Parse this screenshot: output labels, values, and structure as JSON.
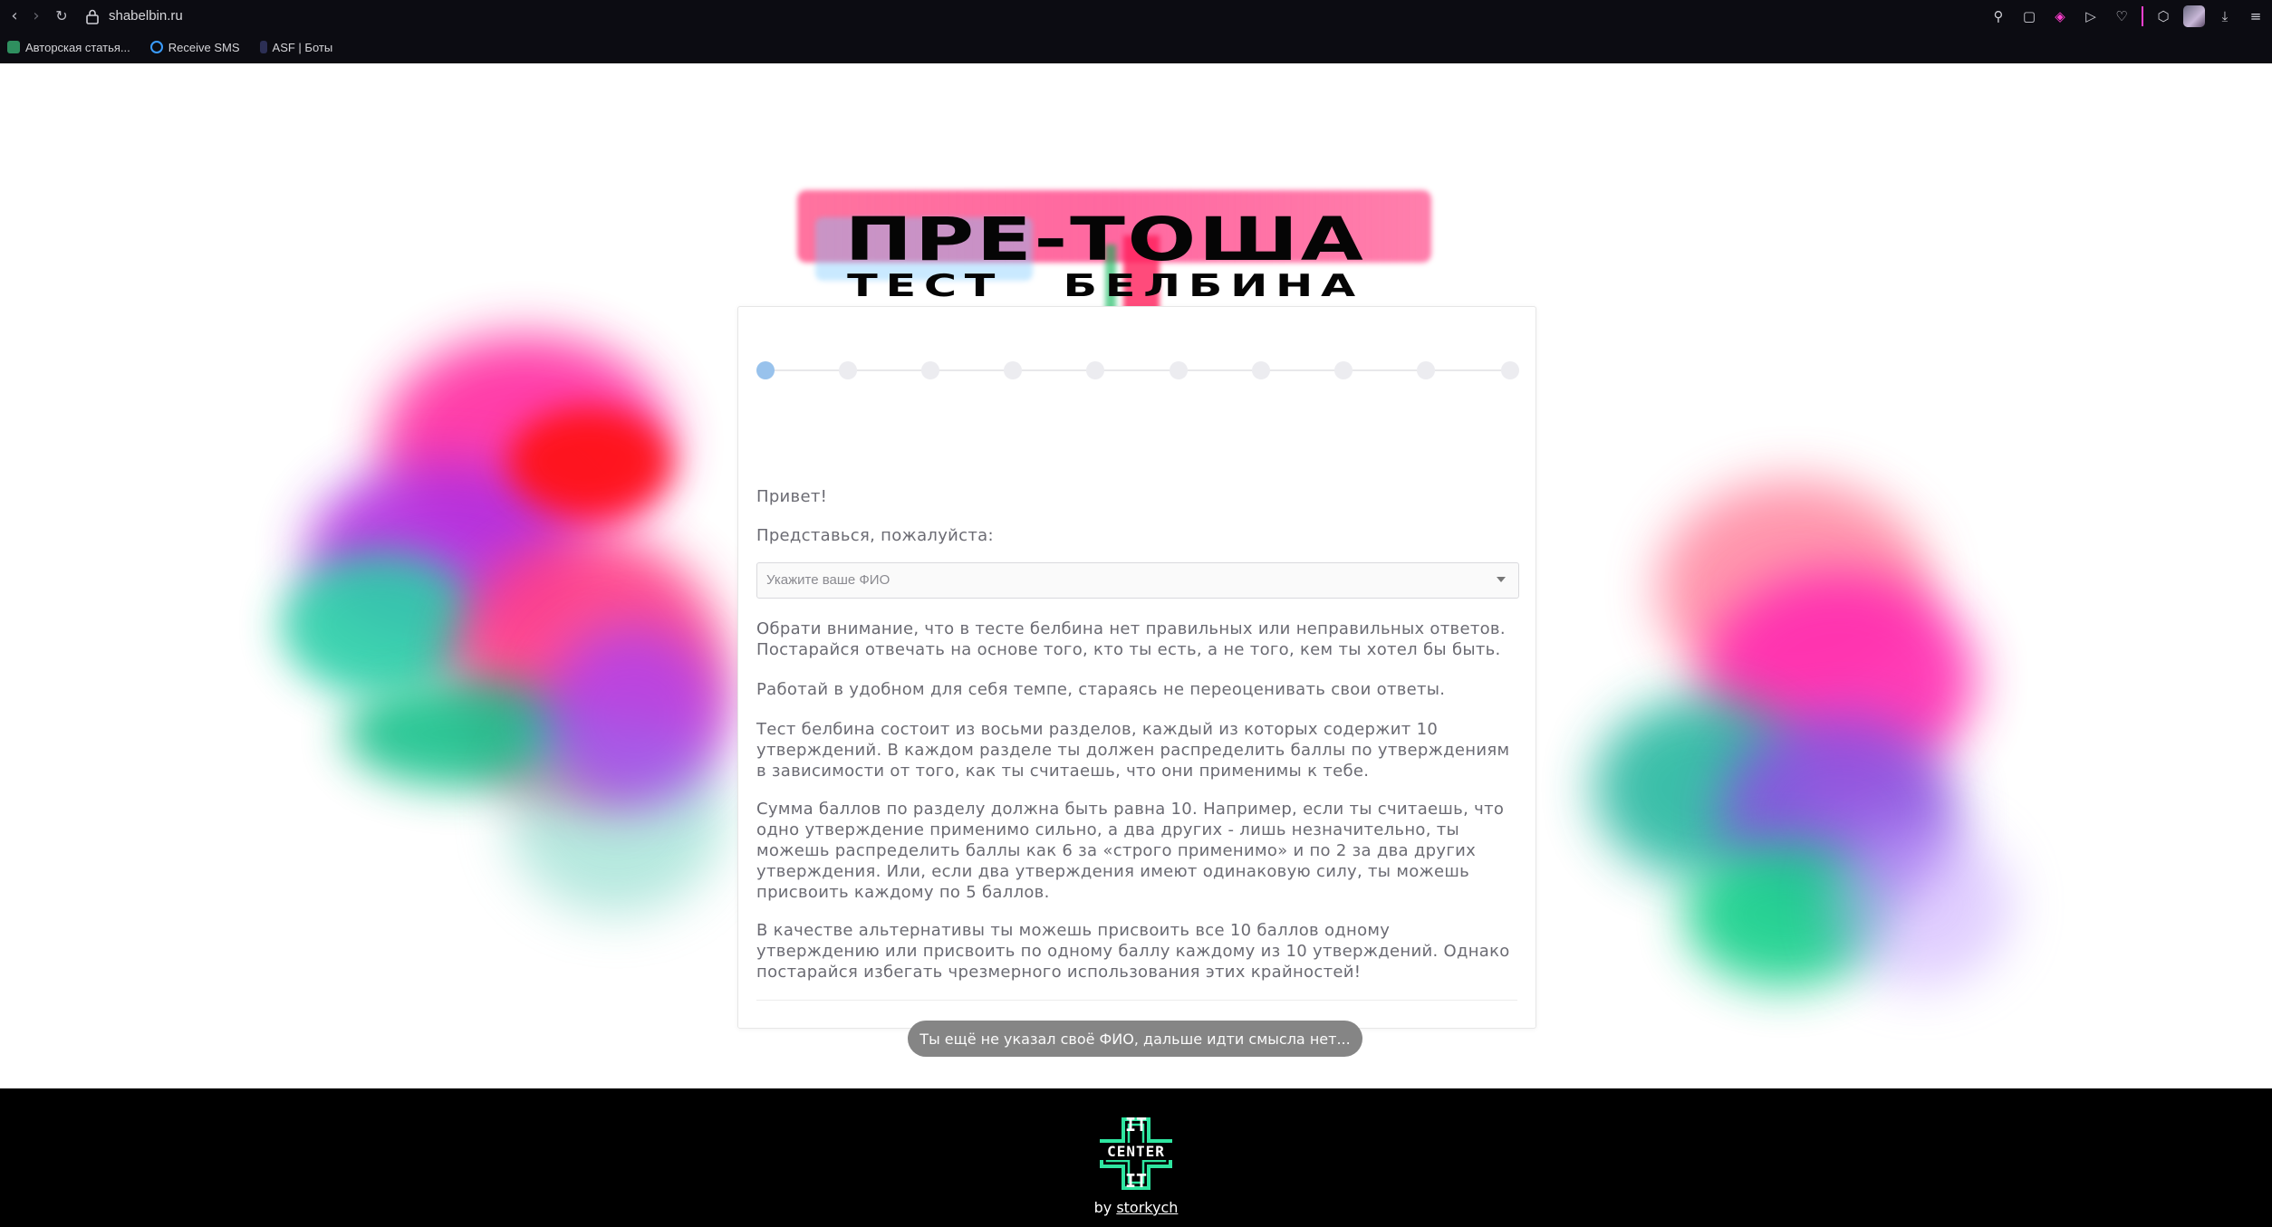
{
  "browser": {
    "url": "shabelbin.ru",
    "bookmarks": [
      {
        "label": "Авторская статья...",
        "icon": "leaf-icon",
        "color": "#39c07a"
      },
      {
        "label": "Receive SMS",
        "icon": "power-icon",
        "color": "#3a9cff"
      },
      {
        "label": "ASF | Боты",
        "icon": "bot-icon",
        "color": "#7a8cff"
      }
    ]
  },
  "hero": {
    "title": "ПРЕ-ТОША",
    "subtitle": "ТЕСТ БЕЛБИНА"
  },
  "form": {
    "steps_total": 10,
    "active_step": 1,
    "greeting": "Привет!",
    "prompt": "Представься, пожалуйста:",
    "select_placeholder": "Укажите ваше ФИО",
    "paragraphs": [
      "Обрати внимание, что в тесте белбина нет правильных или неправильных ответов. Постарайся отвечать на основе того, кто ты есть, а не того, кем ты хотел бы быть.",
      "Работай в удобном для себя темпе, стараясь не переоценивать свои ответы.",
      "Тест белбина состоит из восьми разделов, каждый из которых содержит 10 утверждений. В каждом разделе ты должен распределить баллы по утверждениям в зависимости от того, как ты считаешь, что они применимы к тебе.",
      "Сумма баллов по разделу должна быть равна 10. Например, если ты считаешь, что одно утверждение применимо сильно, а два других - лишь незначительно, ты можешь распределить баллы как 6 за «строго применимо» и по 2 за два других утверждения. Или, если два утверждения имеют одинаковую силу, ты можешь присвоить каждому по 5 баллов.",
      "В качестве альтернативы ты можешь присвоить все 10 баллов одному утверждению или присвоить по одному баллу каждому из 10 утверждений. Однако постарайся избегать чрезмерного использования этих крайностей!"
    ],
    "button_label": "Ты ещё не указал своё ФИО, дальше идти смысла нет..."
  },
  "footer": {
    "logo_top": "IT",
    "logo_mid": "CENTER",
    "logo_bottom": "IT",
    "by_prefix": "by",
    "by_author": "storkych"
  },
  "colors": {
    "step_active": "#98c2ec",
    "step_inactive": "#ececf0",
    "button": "#858585",
    "logo_green": "#2ee6a0"
  }
}
